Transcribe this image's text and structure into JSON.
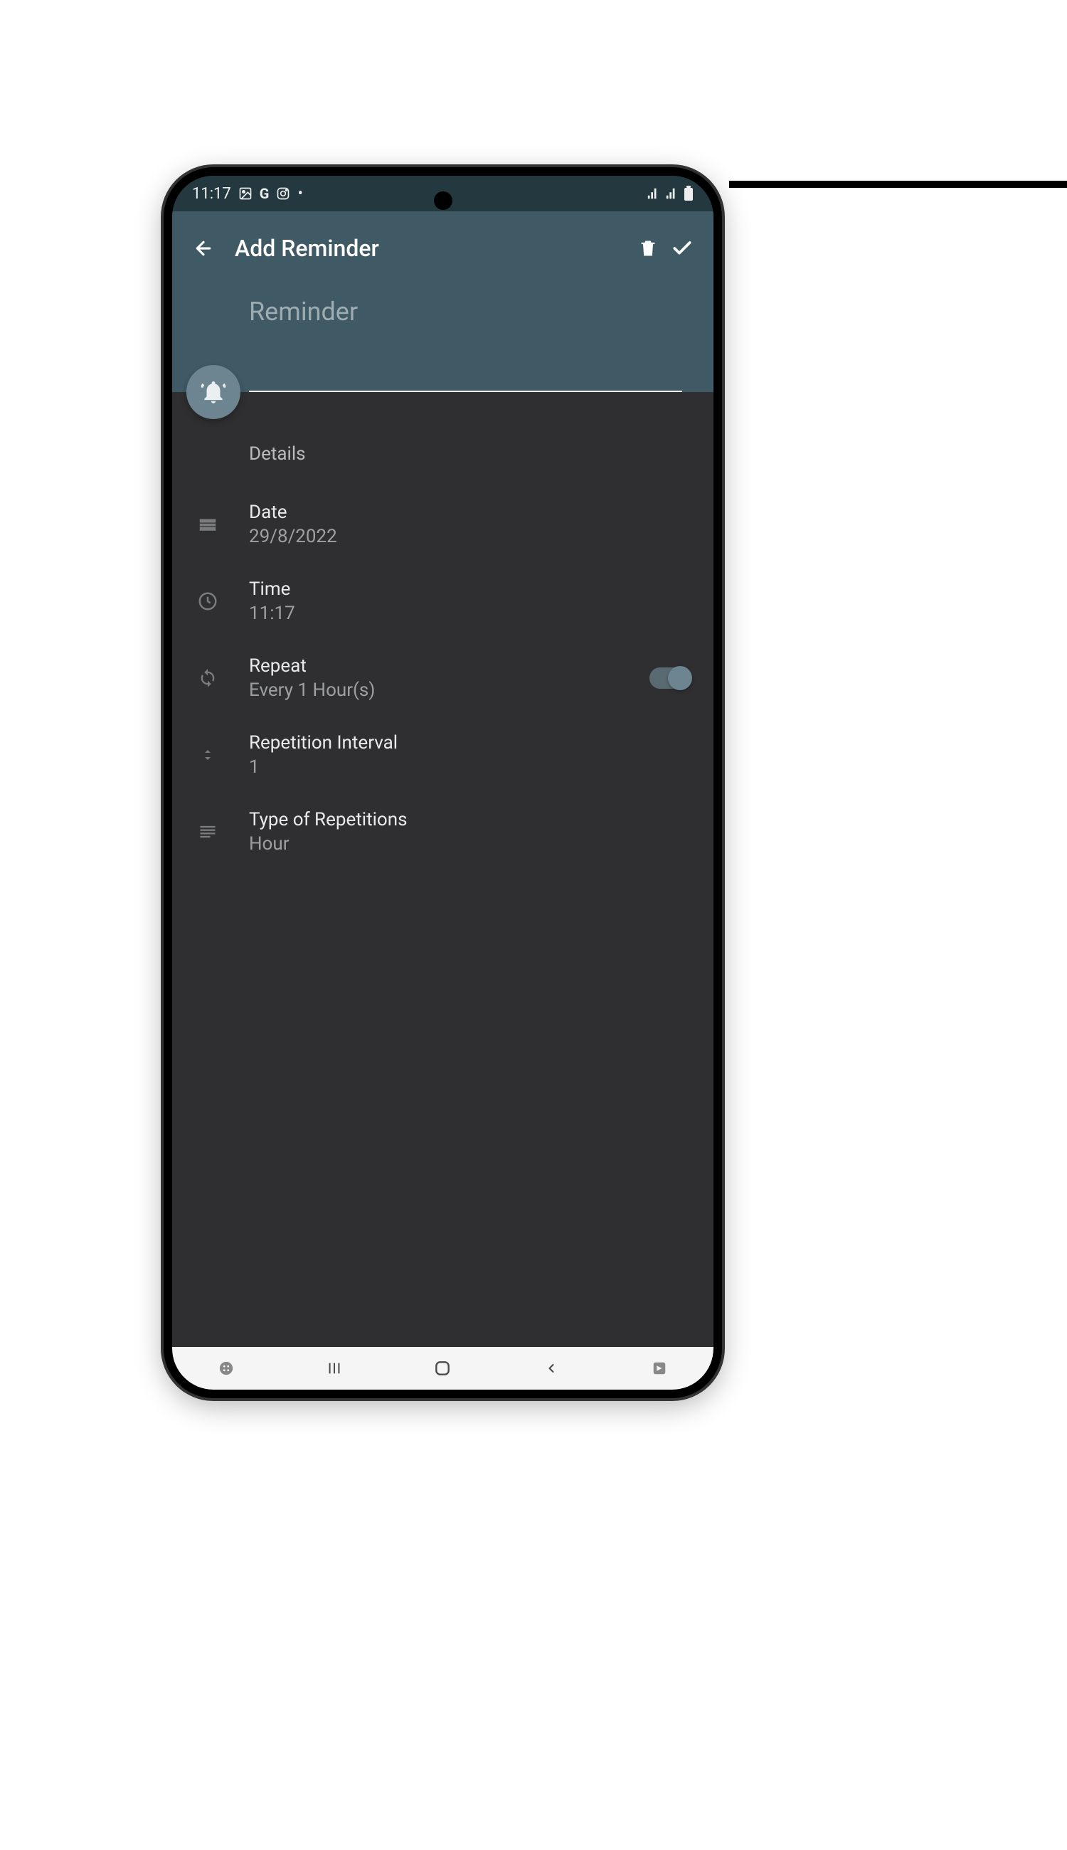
{
  "status": {
    "time": "11:17",
    "icons_left": [
      "image-icon",
      "g-icon",
      "instagram-icon",
      "dot-icon"
    ],
    "icons_right": [
      "signal-icon",
      "signal-icon",
      "battery-icon"
    ]
  },
  "header": {
    "title": "Add Reminder",
    "input_placeholder": "Reminder"
  },
  "sections": {
    "details_label": "Details",
    "date": {
      "label": "Date",
      "value": "29/8/2022"
    },
    "time": {
      "label": "Time",
      "value": "11:17"
    },
    "repeat": {
      "label": "Repeat",
      "value": "Every 1 Hour(s)",
      "enabled": true
    },
    "interval": {
      "label": "Repetition Interval",
      "value": "1"
    },
    "type": {
      "label": "Type of Repetitions",
      "value": "Hour"
    }
  }
}
